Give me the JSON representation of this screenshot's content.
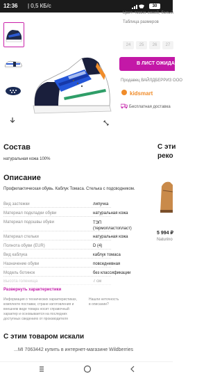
{
  "status_bar": {
    "time": "12:36",
    "speed": "| 0,5 КБ/с",
    "battery": "30"
  },
  "product": {
    "color_label": "Цвет: темно-синий, белый",
    "size_table_label": "Таблица размеров",
    "sizes": [
      "24",
      "25",
      "26",
      "27"
    ],
    "add_to_cart_label": "В ЛИСТ ОЖИДАНИЯ",
    "seller_label": "Продавец ВАЙЛДБЕРРИЗ ООО",
    "brand_label": "kidsmart",
    "free_delivery_label": "Бесплатная доставка"
  },
  "composition": {
    "title": "Состав",
    "text": "натуральная кожа 100%"
  },
  "description": {
    "title": "Описание",
    "text": "Профилактическая обувь. Каблук Томаса. Стелька с подсводником."
  },
  "characteristics": [
    {
      "key": "Вид застежки",
      "value": "липучка"
    },
    {
      "key": "Материал подкладки обуви",
      "value": "натуральная кожа"
    },
    {
      "key": "Материал подошвы обуви",
      "value": "ТЭП (термопластопласт)"
    },
    {
      "key": "Материал стельки",
      "value": "натуральная кожа"
    },
    {
      "key": "Полнота обуви (EUR)",
      "value": "D (4)"
    },
    {
      "key": "Вид каблука",
      "value": "каблук томаса"
    },
    {
      "key": "Назначение обуви",
      "value": "повседневная"
    },
    {
      "key": "Модель ботинок",
      "value": "без классификации"
    },
    {
      "key": "Высота голенища",
      "value": "7 см"
    }
  ],
  "expand_link": "Развернуть характеристики",
  "disclaimer": "Информация о технических характеристиках, комплекте поставки, стране изготовления и внешнем виде товара носит справочный характер и основывается на последних доступных сведениях от производителя",
  "error_link": "Нашли неточность в описании?",
  "also_searched": {
    "title": "С этим товаром искали"
  },
  "right_peek": {
    "title_line1": "С эти",
    "title_line2": "реко",
    "price": "5 994 ₽",
    "brand": "Naturino"
  },
  "url_bar": "...MI 7063442 купить в интернет-магазине Wildberries"
}
